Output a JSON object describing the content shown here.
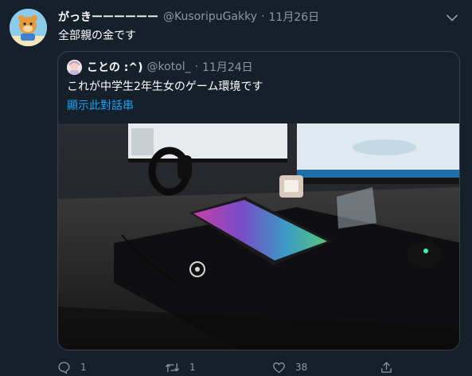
{
  "tweet": {
    "display_name": "がっきーーーーーー",
    "handle": "@KusoripuGakky",
    "separator": "·",
    "date": "11月26日",
    "text": "全部親の金です",
    "avatar_icon": "profile-avatar-icon",
    "more_icon": "chevron-down-icon"
  },
  "quote": {
    "display_name": "ことの :^)",
    "handle": "@kotol_",
    "separator": "·",
    "date": "11月24日",
    "text": "これが中学生2年生女のゲーム環境です",
    "thread_link": "顯示此對話串",
    "media_icon": "photo-desk-setup"
  },
  "actions": {
    "reply_count": "1",
    "retweet_count": "1",
    "like_count": "38",
    "reply_icon": "reply-icon",
    "retweet_icon": "retweet-icon",
    "like_icon": "heart-icon",
    "share_icon": "share-icon"
  },
  "colors": {
    "background": "#15202b",
    "border": "#38444d",
    "muted": "#8899a6",
    "link": "#1da1f2",
    "keyboard_rgb": "#d24dff"
  }
}
